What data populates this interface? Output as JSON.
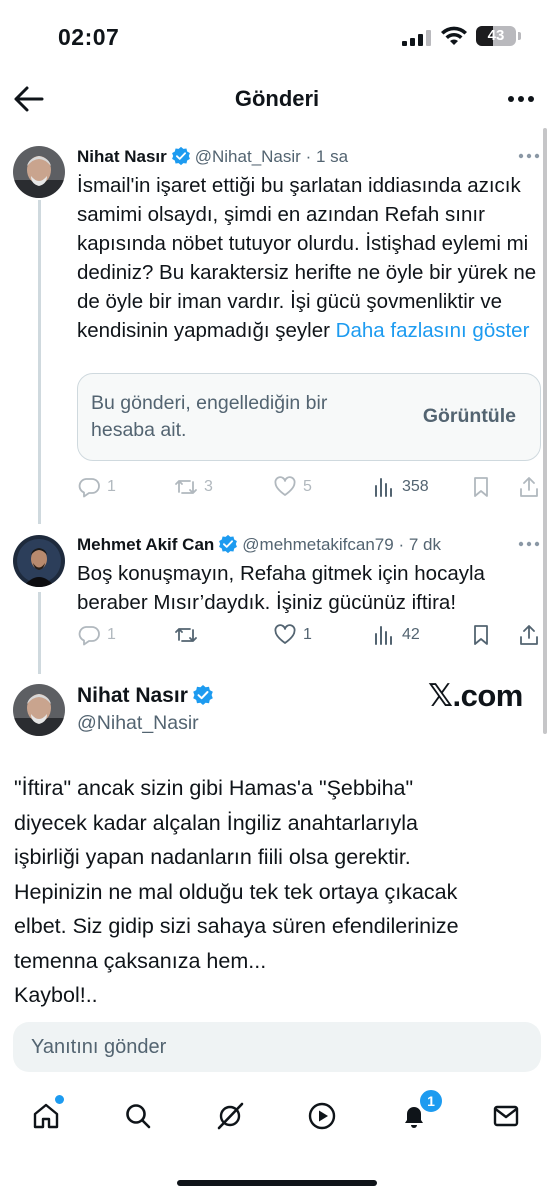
{
  "status_bar": {
    "time": "02:07",
    "battery_text": "43",
    "battery_level": 0.43
  },
  "header": {
    "title": "Gönderi"
  },
  "tweets": [
    {
      "name": "Nihat Nasır",
      "handle": "@Nihat_Nasir",
      "time": "· 1 sa",
      "text": "İsmail'in işaret ettiği bu şarlatan iddiasında azıcık samimi olsaydı, şimdi en azından Refah sınır kapısında nöbet tutuyor olurdu. İstişhad eylemi mi dediniz? Bu karaktersiz herifte ne öyle bir yürek ne de öyle bir iman vardır. İşi gücü şovmenliktir ve kendisinin yapmadığı şeyler",
      "show_more": "Daha fazlasını göster",
      "blocked_message": "Bu gönderi, engellediğin bir hesaba ait.",
      "view_button": "Görüntüle",
      "replies": "1",
      "reposts": "3",
      "likes": "5",
      "views": "358"
    },
    {
      "name": "Mehmet Akif Can",
      "handle": "@mehmetakifcan79",
      "time": "· 7 dk",
      "text": "Boş konuşmayın, Refaha gitmek için hocayla beraber Mısır’daydık. İşiniz gücünüz iftira!",
      "replies": "1",
      "reposts": "",
      "likes": "1",
      "views": "42"
    }
  ],
  "quoted_card": {
    "name": "Nihat Nasır",
    "handle": "@Nihat_Nasir",
    "watermark": "𝕏.com",
    "text_lines": [
      "\"İftira\" ancak sizin gibi Hamas'a \"Şebbiha\"",
      "diyecek kadar alçalan İngiliz anahtarlarıyla",
      "işbirliği yapan nadanların fiili olsa gerektir.",
      "Hepinizin ne mal olduğu tek tek ortaya çıkacak",
      "elbet. Siz gidip sizi sahaya süren efendilerinize",
      "temenna çaksanıza hem...",
      "Kaybol!.."
    ]
  },
  "reply_input": {
    "placeholder": "Yanıtını gönder"
  },
  "tab_bar": {
    "notifications_badge": "1",
    "items": [
      "home-icon",
      "search-icon",
      "grok-icon",
      "video-icon",
      "bell-icon",
      "mail-icon"
    ]
  },
  "colors": {
    "accent": "#1d9bf0",
    "text": "#0f1419",
    "secondary": "#536471",
    "border": "#cfd9de"
  }
}
